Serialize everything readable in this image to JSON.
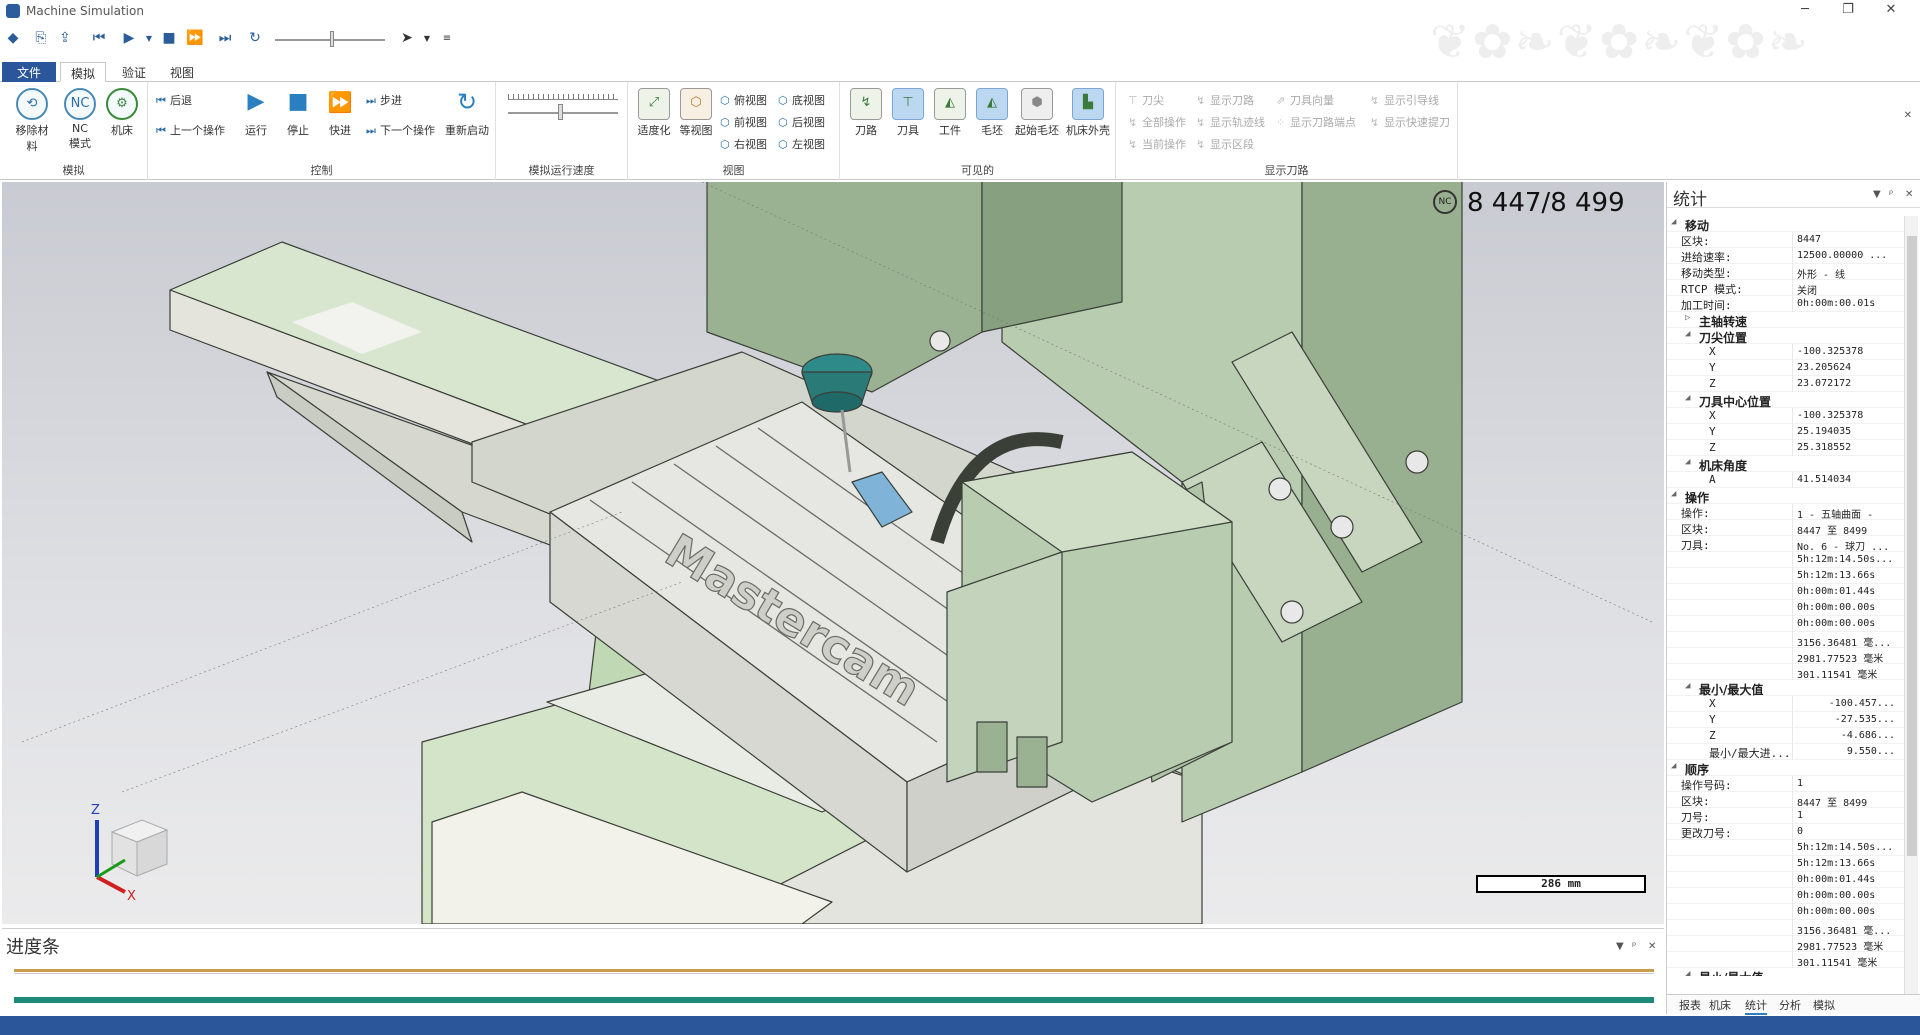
{
  "app": {
    "title": "Machine Simulation"
  },
  "window_controls": {
    "minimize": "─",
    "restore": "❐",
    "close": "✕"
  },
  "tabs": [
    {
      "label": "文件"
    },
    {
      "label": "模拟"
    },
    {
      "label": "验证"
    },
    {
      "label": "视图"
    }
  ],
  "ribbon": {
    "groups": {
      "simulate": {
        "label": "模拟",
        "remove_material": "移除材料",
        "nc": "NC",
        "nc_mode": "NC\n模式",
        "machine": "机床"
      },
      "control": {
        "label": "控制",
        "back": "后退",
        "prev_op": "上一个操作",
        "run": "运行",
        "stop": "停止",
        "fast": "快进",
        "step": "步进",
        "next_op": "下一个操作",
        "restart": "重新启动"
      },
      "speed": {
        "label": "模拟运行速度"
      },
      "view": {
        "label": "视图",
        "fit": "适度化",
        "iso": "等视图",
        "top": "俯视图",
        "bottom": "底视图",
        "front": "前视图",
        "back": "后视图",
        "right": "右视图",
        "left": "左视图"
      },
      "visible": {
        "label": "可见的",
        "toolpath": "刀路",
        "tool": "刀具",
        "workpiece": "工件",
        "stock": "毛坯",
        "initial_stock": "起始毛坯",
        "machine_housing": "机床外壳"
      },
      "display_toolpath": {
        "label": "显示刀路",
        "tool_tip": "刀尖",
        "all_ops": "全部操作",
        "current_op": "当前操作",
        "show_toolpath": "显示刀路",
        "show_trace": "显示轨迹线",
        "show_segment": "显示区段",
        "tool_vector": "刀具向量",
        "toolpath_points": "显示刀路端点",
        "show_leads": "显示引导线",
        "show_rapid": "显示快速提刀"
      }
    }
  },
  "viewport": {
    "counter": "8 447/8 499",
    "nc_badge": "NC",
    "scale": "286 mm",
    "brand": "Mastercam",
    "axis_z": "Z",
    "axis_x": "X"
  },
  "stats": {
    "title": "统计",
    "rows": [
      {
        "type": "sec",
        "label": "移动",
        "open": true,
        "level": 0
      },
      {
        "label": "区块:",
        "value": "8447"
      },
      {
        "label": "进给速率:",
        "value": "12500.00000 ..."
      },
      {
        "label": "移动类型:",
        "value": "外形 - 线"
      },
      {
        "label": "RTCP 模式:",
        "value": "关闭"
      },
      {
        "label": "加工时间:",
        "value": "0h:00m:00.01s"
      },
      {
        "type": "sec",
        "label": "主轴转速",
        "open": false,
        "level": 1
      },
      {
        "type": "sec",
        "label": "刀尖位置",
        "open": true,
        "level": 1
      },
      {
        "label": "X",
        "value": "-100.325378",
        "level": 2
      },
      {
        "label": "Y",
        "value": "23.205624",
        "level": 2
      },
      {
        "label": "Z",
        "value": "23.072172",
        "level": 2
      },
      {
        "type": "sec",
        "label": "刀具中心位置",
        "open": true,
        "level": 1
      },
      {
        "label": "X",
        "value": "-100.325378",
        "level": 2
      },
      {
        "label": "Y",
        "value": "25.194035",
        "level": 2
      },
      {
        "label": "Z",
        "value": "25.318552",
        "level": 2
      },
      {
        "type": "sec",
        "label": "机床角度",
        "open": true,
        "level": 1
      },
      {
        "label": "A",
        "value": "41.514034",
        "level": 2
      },
      {
        "type": "sec",
        "label": "操作",
        "open": true,
        "level": 0
      },
      {
        "label": "操作:",
        "value": "1 - 五轴曲面 -"
      },
      {
        "label": "区块:",
        "value": "8447 至 8499"
      },
      {
        "label": "刀具:",
        "value": "No. 6 - 球刀 ..."
      },
      {
        "label": "",
        "value": "5h:12m:14.50s..."
      },
      {
        "label": "",
        "value": "5h:12m:13.66s"
      },
      {
        "label": "",
        "value": "0h:00m:01.44s"
      },
      {
        "label": "",
        "value": "0h:00m:00.00s"
      },
      {
        "label": "",
        "value": "0h:00m:00.00s"
      },
      {
        "label": "",
        "value": "3156.36481 毫..."
      },
      {
        "label": "",
        "value": "2981.77523 毫米"
      },
      {
        "label": "",
        "value": "301.11541 毫米"
      },
      {
        "type": "sec",
        "label": "最小/最大值",
        "open": true,
        "level": 1
      },
      {
        "label": "X",
        "value": "-100.457...",
        "level": 2,
        "right": true
      },
      {
        "label": "Y",
        "value": "-27.535...",
        "level": 2,
        "right": true
      },
      {
        "label": "Z",
        "value": "-4.686...",
        "level": 2,
        "right": true
      },
      {
        "label": "最小/最大进...",
        "value": "9.550...",
        "level": 2,
        "right": true
      },
      {
        "type": "sec",
        "label": "顺序",
        "open": true,
        "level": 0
      },
      {
        "label": "操作号码:",
        "value": "1"
      },
      {
        "label": "区块:",
        "value": "8447 至 8499"
      },
      {
        "label": "刀号:",
        "value": "1"
      },
      {
        "label": "更改刀号:",
        "value": "0"
      },
      {
        "label": "",
        "value": "5h:12m:14.50s..."
      },
      {
        "label": "",
        "value": "5h:12m:13.66s"
      },
      {
        "label": "",
        "value": "0h:00m:01.44s"
      },
      {
        "label": "",
        "value": "0h:00m:00.00s"
      },
      {
        "label": "",
        "value": "0h:00m:00.00s"
      },
      {
        "label": "",
        "value": "3156.36481 毫..."
      },
      {
        "label": "",
        "value": "2981.77523 毫米"
      },
      {
        "label": "",
        "value": "301.11541 毫米"
      },
      {
        "type": "sec",
        "label": "最小/最大值",
        "open": true,
        "level": 1
      }
    ],
    "bottom_tabs": [
      {
        "label": "报表"
      },
      {
        "label": "机床"
      },
      {
        "label": "统计"
      },
      {
        "label": "分析"
      },
      {
        "label": "模拟"
      }
    ]
  },
  "progress": {
    "title": "进度条"
  },
  "panel_controls": {
    "dropdown": "▼",
    "pin": "ᵖ",
    "close": "✕"
  }
}
